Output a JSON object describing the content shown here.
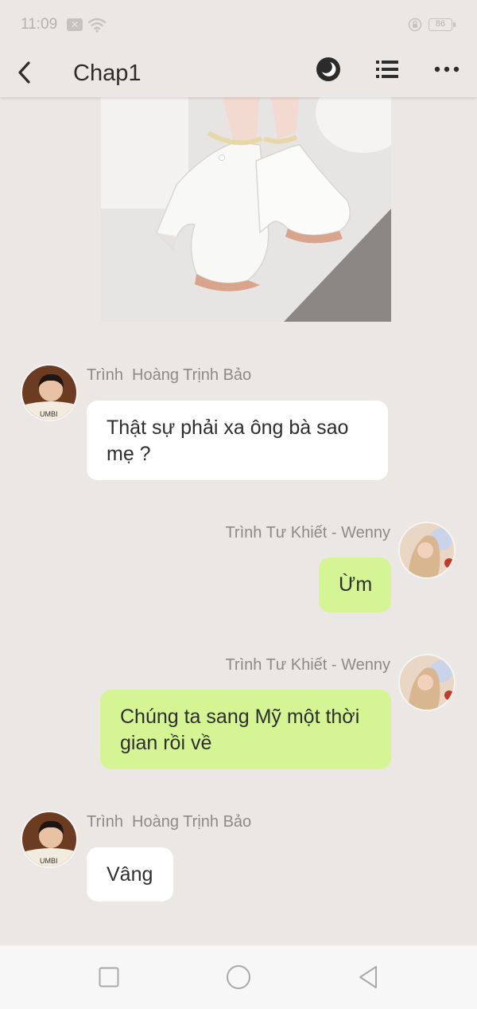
{
  "status_bar": {
    "time": "11:09",
    "battery": "86",
    "icons": [
      "notification-x-icon",
      "wifi-icon",
      "rotation-lock-icon",
      "battery-icon"
    ]
  },
  "app_bar": {
    "title": "Chap1",
    "icons": [
      "back-arrow-icon",
      "night-mode-icon",
      "list-icon",
      "more-icon"
    ]
  },
  "messages": [
    {
      "side": "left",
      "sender": "Trình  Hoàng Trịnh Bảo",
      "text": "Thật sự phải xa ông bà sao mẹ ?",
      "bubble_color": "#ffffff"
    },
    {
      "side": "right",
      "sender": "Trình Tư Khiết - Wenny",
      "text": "Ừm",
      "bubble_color": "#d5f594"
    },
    {
      "side": "right",
      "sender": "Trình Tư Khiết - Wenny",
      "text": "Chúng ta sang Mỹ  một thời gian rồi về",
      "bubble_color": "#d5f594"
    },
    {
      "side": "left",
      "sender": "Trình  Hoàng Trịnh Bảo",
      "text": "Vâng",
      "bubble_color": "#ffffff"
    }
  ],
  "nav_bar": {
    "icons": [
      "recent-apps-icon",
      "home-icon",
      "back-triangle-icon"
    ]
  }
}
